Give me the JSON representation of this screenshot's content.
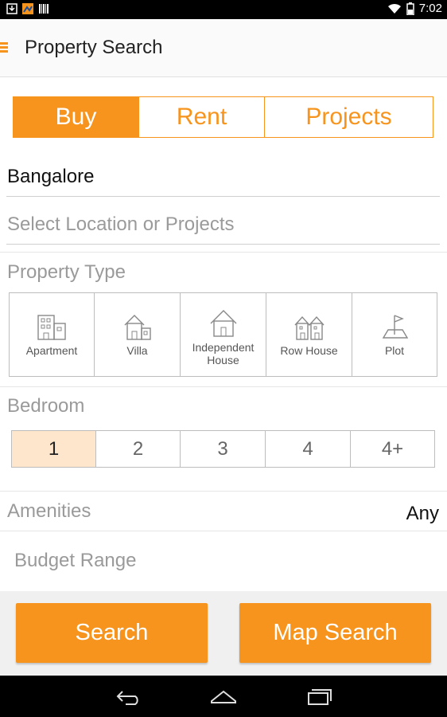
{
  "status_bar": {
    "time": "7:02"
  },
  "app_bar": {
    "title": "Property Search"
  },
  "mode_tabs": [
    {
      "label": "Buy",
      "active": true
    },
    {
      "label": "Rent",
      "active": false
    },
    {
      "label": "Projects",
      "active": false
    }
  ],
  "city": "Bangalore",
  "location_placeholder": "Select Location or Projects",
  "property_type": {
    "label": "Property Type",
    "items": [
      {
        "label": "Apartment",
        "icon": "apartment-icon"
      },
      {
        "label": "Villa",
        "icon": "villa-icon"
      },
      {
        "label": "Independent House",
        "icon": "house-icon"
      },
      {
        "label": "Row House",
        "icon": "row-house-icon"
      },
      {
        "label": "Plot",
        "icon": "plot-icon"
      }
    ]
  },
  "bedroom": {
    "label": "Bedroom",
    "options": [
      "1",
      "2",
      "3",
      "4",
      "4+"
    ],
    "selected": "1"
  },
  "amenities": {
    "label": "Amenities",
    "value": "Any"
  },
  "budget": {
    "label": "Budget Range"
  },
  "actions": {
    "search": "Search",
    "map_search": "Map Search"
  },
  "colors": {
    "accent": "#f7941d",
    "selected_bg": "#fde6cc"
  }
}
